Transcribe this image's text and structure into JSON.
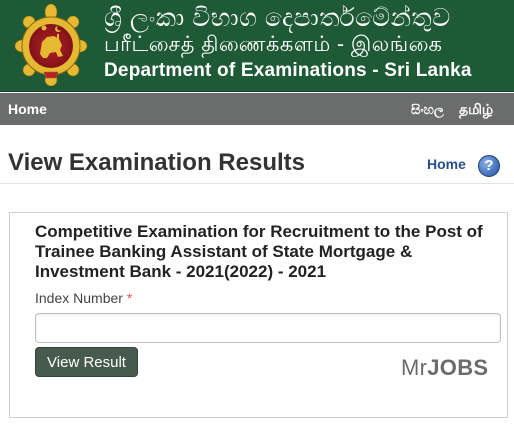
{
  "banner": {
    "sinhala": "ශ්‍රී ලංකා විභාග දෙපාර්තමේන්තුව",
    "tamil": "பரீட்சைத் திணைக்களம் - இலங்கை",
    "english": "Department of Examinations - Sri Lanka",
    "bg_color": "#1f5a36",
    "emblem_icon": "sri-lanka-emblem-icon"
  },
  "nav": {
    "home": "Home",
    "sinhala": "සිංහල",
    "tamil": "தமிழ்",
    "bg_color": "#6b6d6c"
  },
  "header": {
    "title": "View Examination Results",
    "home_link": "Home",
    "help_icon": "help-icon",
    "help_glyph": "?"
  },
  "form": {
    "exam_title": "Competitive Examination for Recruitment to the Post of Trainee Banking Assistant of State Mortgage & Investment Bank - 2021(2022) - 2021",
    "index_label": "Index Number",
    "required_mark": "*",
    "index_value": "",
    "button_label": "View Result",
    "button_color": "#465a4e"
  },
  "watermark": {
    "prefix": "Mr",
    "bold": "JOBS"
  }
}
